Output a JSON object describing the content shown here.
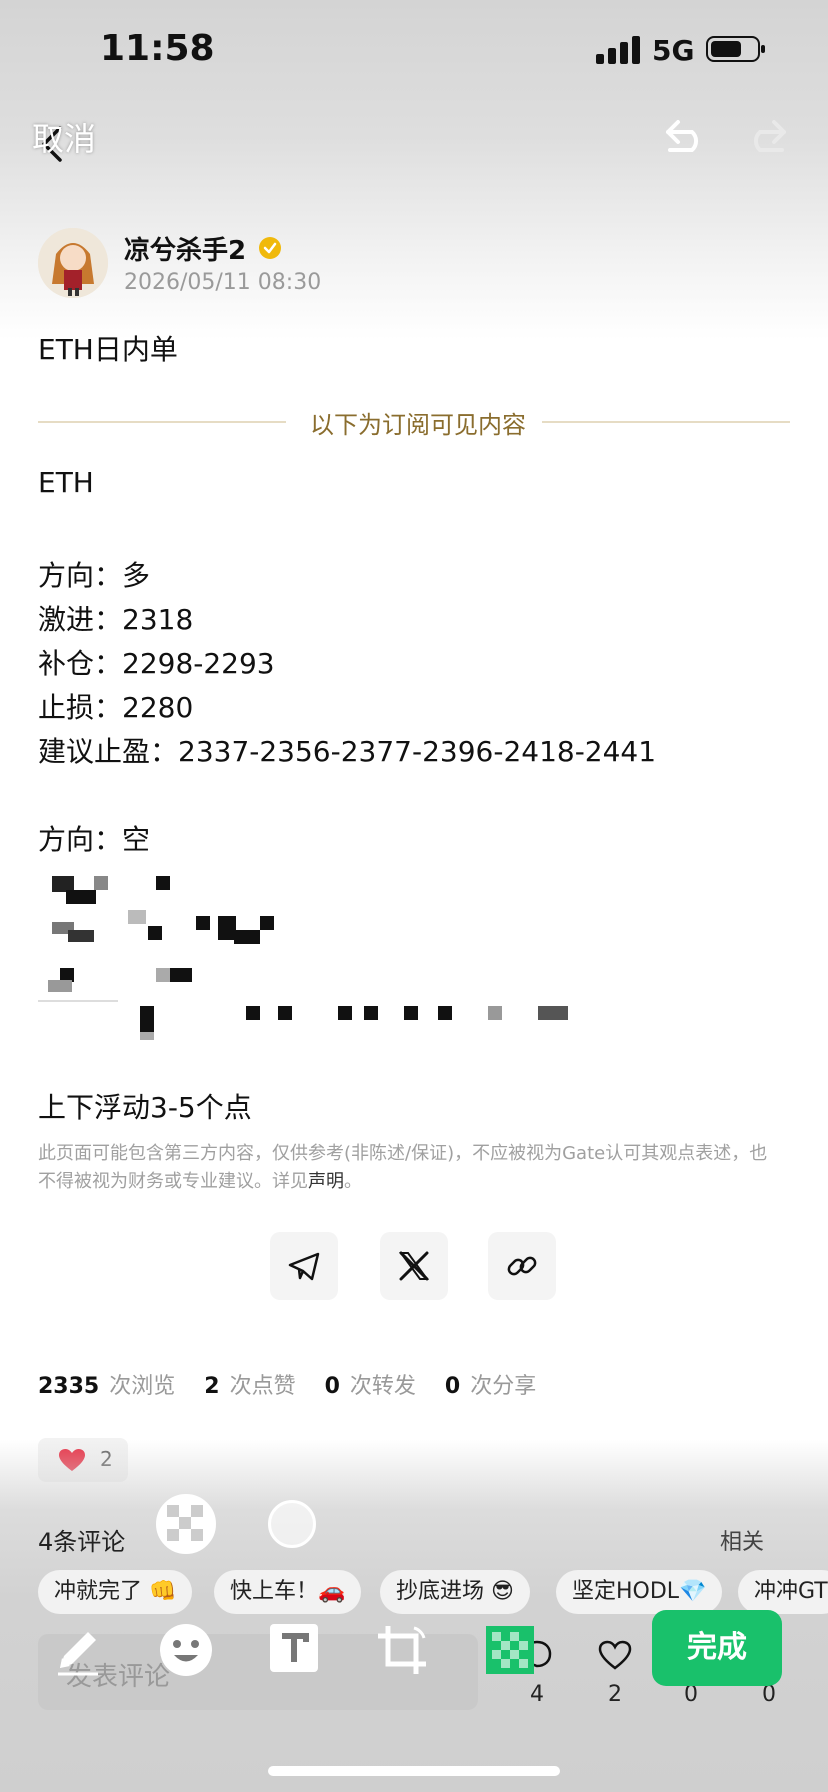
{
  "status_bar": {
    "time": "11:58",
    "network": "5G"
  },
  "edit_bar": {
    "cancel_label": "取消"
  },
  "post": {
    "author": "凉兮杀手2",
    "date": "2026/05/11 08:30",
    "headline": "ETH日内单",
    "divider_text": "以下为订阅可见内容",
    "lines": [
      "ETH",
      "方向：多",
      "激进：2318",
      "补仓：2298-2293",
      "止损：2280",
      "建议止盈：2337-2356-2377-2396-2418-2441",
      "方向：空",
      "上下浮动3-5个点"
    ],
    "disclaimer_text": "此页面可能包含第三方内容，仅供参考(非陈述/保证)，不应被视为Gate认可其观点表述，也不得被视为财务或专业建议。详见",
    "disclaimer_link": "声明",
    "disclaimer_end": "。"
  },
  "stats": {
    "views": "2335",
    "views_label": "次浏览",
    "likes": "2",
    "likes_label": "次点赞",
    "reposts": "0",
    "reposts_label": "次转发",
    "shares": "0",
    "shares_label": "次分享"
  },
  "reaction": {
    "count": "2"
  },
  "comments": {
    "heading": "4条评论",
    "related": "相关",
    "quick_replies": [
      "冲就完了 👊",
      "快上车！🚗",
      "抄底进场 😎",
      "坚定HODL💎",
      "冲冲GT"
    ],
    "input_placeholder": "发表评论"
  },
  "bottom_stats": {
    "comments": "4",
    "likes": "2",
    "reposts": "0",
    "shares": "0"
  },
  "editor": {
    "done_label": "完成"
  },
  "colors": {
    "accent_green": "#19c16b",
    "divider_gold": "#8a6d2e",
    "heart_red": "#e8364a"
  }
}
